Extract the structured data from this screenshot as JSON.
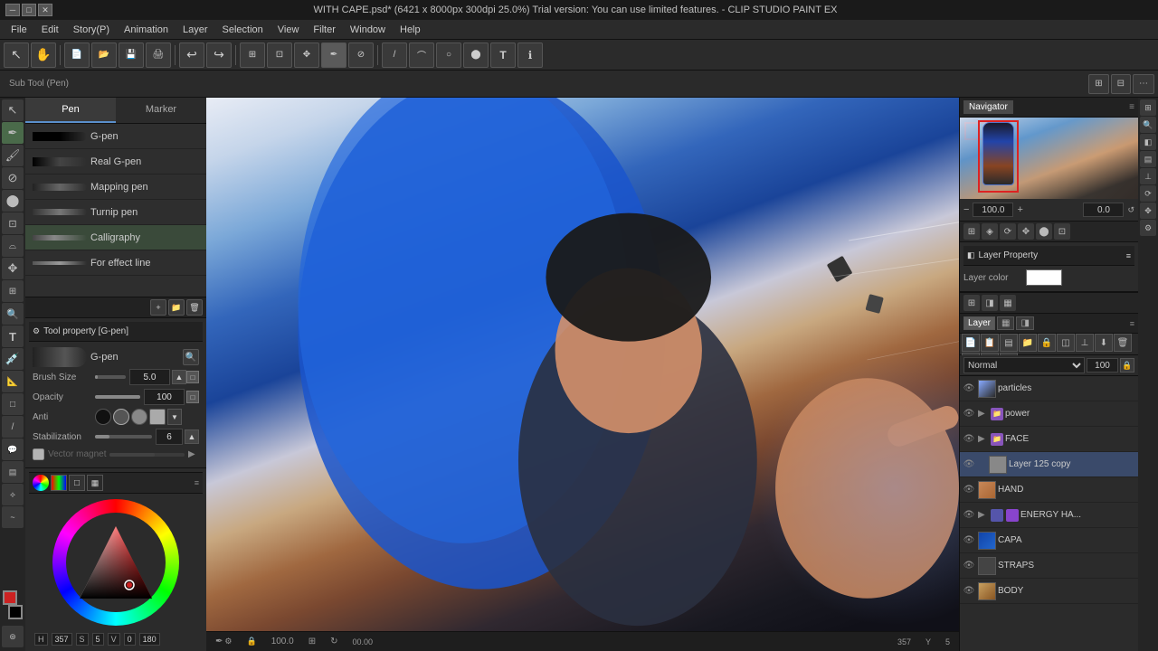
{
  "titlebar": {
    "title": "WITH CAPE.psd* (6421 x 8000px 300dpi 25.0%)  Trial version: You can use limited features. - CLIP STUDIO PAINT EX",
    "minimize": "─",
    "maximize": "□",
    "close": "✕"
  },
  "menubar": {
    "items": [
      "File",
      "Edit",
      "Story(P)",
      "Animation",
      "Layer",
      "Selection",
      "View",
      "Filter",
      "Window",
      "Help"
    ]
  },
  "subtoolbar": {
    "label": "Sub Tool (Pen)"
  },
  "tool_tabs": {
    "pen": "Pen",
    "marker": "Marker"
  },
  "brush_list": [
    {
      "name": "G-pen",
      "weight": "heavy"
    },
    {
      "name": "Real G-pen",
      "weight": "heavy"
    },
    {
      "name": "Mapping pen",
      "weight": "medium"
    },
    {
      "name": "Turnip pen",
      "weight": "medium"
    },
    {
      "name": "Calligraphy",
      "weight": "light"
    },
    {
      "name": "For effect line",
      "weight": "light"
    }
  ],
  "tool_property": {
    "header": "Tool property [G-pen]",
    "brush_name": "G-pen",
    "brush_size_label": "Brush Size",
    "brush_size_value": "5.0",
    "opacity_label": "Opacity",
    "opacity_value": "100",
    "anti_label": "Anti",
    "stabilization_label": "Stabilization",
    "stabilization_value": "6",
    "vector_magnet_label": "Vector magnet"
  },
  "color_panel": {
    "h_value": "357",
    "s_value": "5",
    "v_value": "0",
    "extra": "180"
  },
  "navigator": {
    "tab_label": "Navigator",
    "zoom_value": "100.0",
    "zoom_value2": "0.0"
  },
  "layer_property": {
    "header": "Layer Property",
    "layer_color_label": "Layer color"
  },
  "layer_panel": {
    "header": "Layer",
    "tabs": [
      "Layer",
      "▦",
      "◨"
    ],
    "layers": [
      {
        "name": "particles",
        "type": "layer",
        "visible": true,
        "indent": 0
      },
      {
        "name": "power",
        "type": "folder",
        "visible": true,
        "indent": 0,
        "has_expand": true
      },
      {
        "name": "FACE",
        "type": "folder",
        "visible": true,
        "indent": 0,
        "has_expand": true
      },
      {
        "name": "Layer 125 copy",
        "type": "layer",
        "visible": true,
        "indent": 1,
        "selected": true
      },
      {
        "name": "HAND",
        "type": "layer",
        "visible": true,
        "indent": 0
      },
      {
        "name": "ENERGY HA...",
        "type": "folder",
        "visible": true,
        "indent": 0,
        "has_expand": true
      },
      {
        "name": "CAPA",
        "type": "layer",
        "visible": true,
        "indent": 0
      },
      {
        "name": "STRAPS",
        "type": "layer",
        "visible": true,
        "indent": 0
      },
      {
        "name": "BODY",
        "type": "layer",
        "visible": true,
        "indent": 0
      }
    ]
  },
  "statusbar": {
    "zoom": "100.0",
    "position": "357",
    "y": "5",
    "extra1": "0",
    "extra2": "Y",
    "extra3": "0"
  }
}
